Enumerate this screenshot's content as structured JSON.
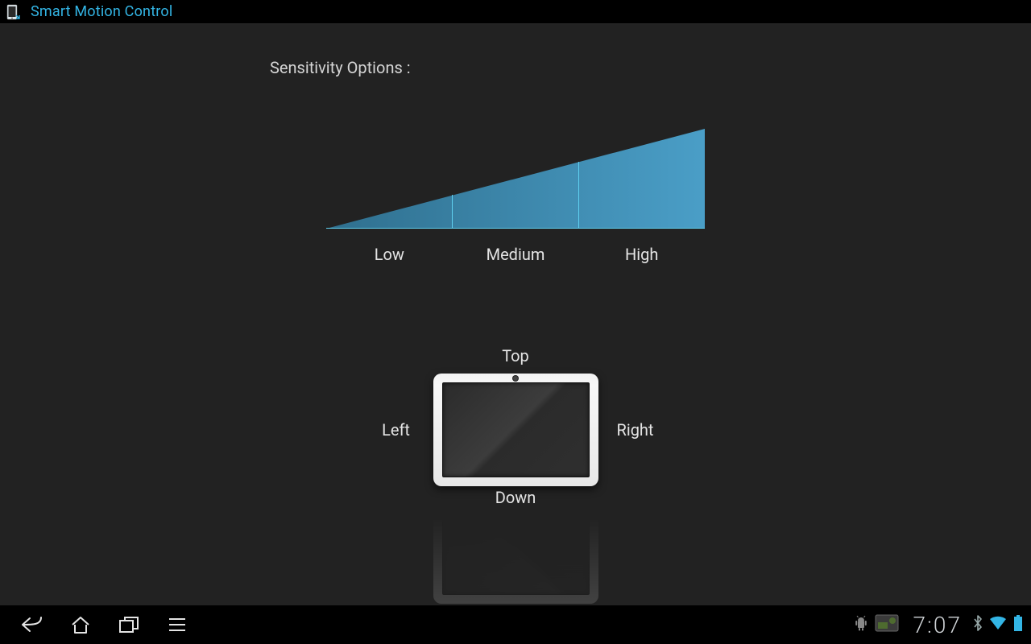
{
  "header": {
    "title": "Smart Motion Control"
  },
  "body": {
    "heading": "Sensitivity Options :",
    "levels": {
      "low": "Low",
      "medium": "Medium",
      "high": "High"
    },
    "directions": {
      "top": "Top",
      "left": "Left",
      "right": "Right",
      "down": "Down"
    }
  },
  "status": {
    "clock": "7:07"
  }
}
